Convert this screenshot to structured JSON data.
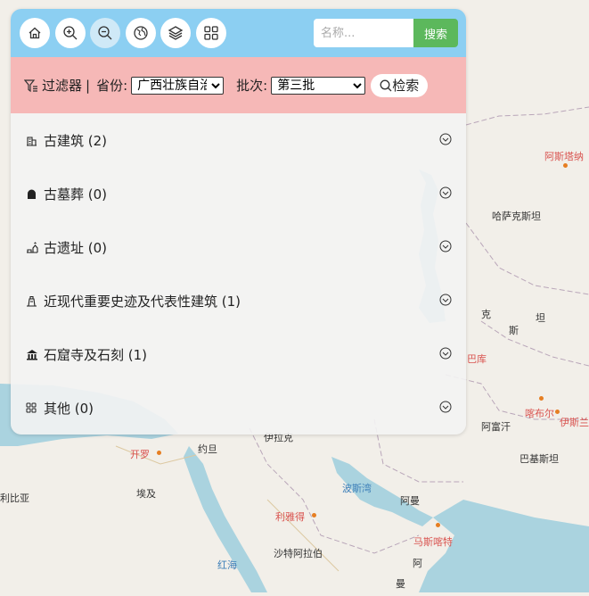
{
  "toolbar": {
    "buttons": [
      {
        "icon": "home-icon"
      },
      {
        "icon": "zoom-in-icon"
      },
      {
        "icon": "zoom-out-icon"
      },
      {
        "icon": "globe-icon"
      },
      {
        "icon": "layers-icon"
      },
      {
        "icon": "grid-icon"
      }
    ],
    "search_placeholder": "名称...",
    "search_button": "搜索"
  },
  "filter": {
    "label": "过滤器",
    "separator": "|",
    "province_label": "省份:",
    "province_value": "广西壮族自治区",
    "batch_label": "批次:",
    "batch_value": "第三批",
    "query_label": "检索"
  },
  "categories": [
    {
      "label": "古建筑 (2)",
      "icon": "ancient-building-icon"
    },
    {
      "label": "古墓葬 (0)",
      "icon": "ancient-tomb-icon"
    },
    {
      "label": "古遗址 (0)",
      "icon": "ancient-site-icon"
    },
    {
      "label": "近现代重要史迹及代表性建筑 (1)",
      "icon": "modern-site-icon"
    },
    {
      "label": "石窟寺及石刻 (1)",
      "icon": "grotto-temple-icon"
    },
    {
      "label": "其他 (0)",
      "icon": "other-icon"
    }
  ],
  "map": {
    "labels": {
      "astana": "阿斯塔纳",
      "kazakhstan": "哈萨克斯坦",
      "ke": "克",
      "tan": "坦",
      "si": "斯",
      "baku": "巴库",
      "kabul": "喀布尔",
      "afghanistan": "阿富汗",
      "islamabad_fragment": "伊斯兰",
      "pakistan": "巴基斯坦",
      "cairo": "开罗",
      "jordan": "约旦",
      "iraq_fragment": "伊拉克",
      "egypt": "埃及",
      "libya_fragment": "利比亚",
      "persian_gulf": "波斯湾",
      "oman_1": "阿曼",
      "riyadh": "利雅得",
      "muscat": "马斯喀特",
      "saudi_arabia": "沙特阿拉伯",
      "red_sea": "红海",
      "oman_2": "阿",
      "yemen_fragment": "曼"
    }
  }
}
